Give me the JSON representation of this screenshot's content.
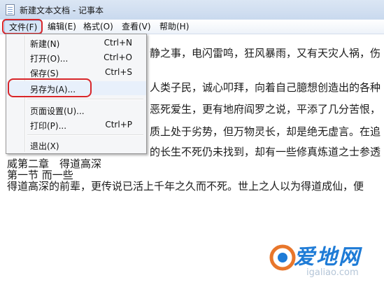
{
  "window": {
    "title": "新建文本文档 - 记事本"
  },
  "menubar": {
    "items": [
      "文件(F)",
      "编辑(E)",
      "格式(O)",
      "查看(V)",
      "帮助(H)"
    ]
  },
  "file_menu": {
    "items": [
      {
        "label": "新建(N)",
        "shortcut": "Ctrl+N"
      },
      {
        "label": "打开(O)...",
        "shortcut": "Ctrl+O"
      },
      {
        "label": "保存(S)",
        "shortcut": "Ctrl+S"
      },
      {
        "label": "另存为(A)...",
        "shortcut": ""
      },
      {
        "label": "页面设置(U)...",
        "shortcut": ""
      },
      {
        "label": "打印(P)...",
        "shortcut": "Ctrl+P"
      },
      {
        "label": "退出(X)",
        "shortcut": ""
      }
    ]
  },
  "editor": {
    "lines": [
      "静之事，电闪雷鸣，狂风暴雨，又有天灾人祸，伤",
      "人类子民，诚心叩拜，向着自己臆想创造出的各种",
      "恶死爱生，更有地府阎罗之说，平添了几分苦恨，",
      "质上处于劣势，但万物灵长，却是绝无虚言。在追",
      "的长生不死仍未找到，却有一些修真炼道之士参透",
      "威第二章　得道高深",
      "第一节  而一些",
      "得道高深的前辈，更传说已活上千年之久而不死。世上之人以为得道成仙，便"
    ]
  },
  "watermark": {
    "text": "爱地网",
    "url": "igaliao.com"
  },
  "colors": {
    "highlight": "#d8262a",
    "title_bar": "#c9d9ee"
  }
}
